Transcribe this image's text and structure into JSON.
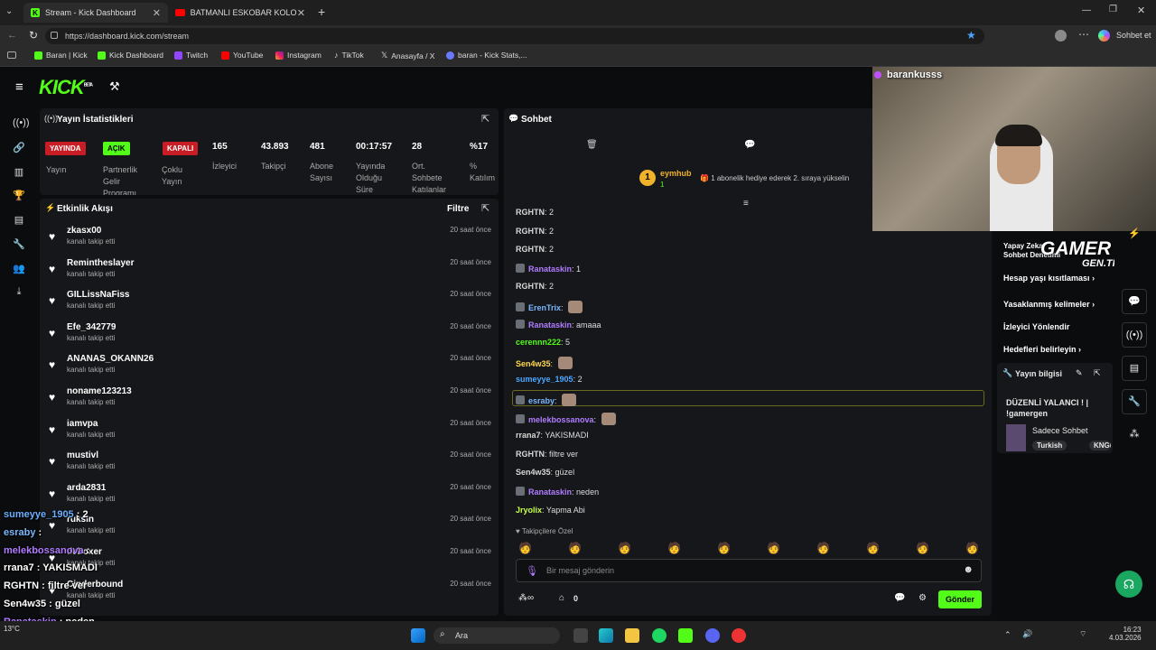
{
  "browser": {
    "tabs": [
      {
        "title": "Stream - Kick Dashboard"
      },
      {
        "title": "BATMANLI ESKOBAR KOLOMBİYA'"
      }
    ],
    "url": "https://dashboard.kick.com/stream",
    "copilot": "Sohbet et",
    "bookmarks": [
      "Baran | Kick",
      "Kick Dashboard",
      "Twitch",
      "YouTube",
      "Instagram",
      "TikTok",
      "Anasayfa / X",
      "baran - Kick Stats,..."
    ]
  },
  "logo": "KICK",
  "logo_beta": "BETA",
  "stats": {
    "title": "Yayın İstatistikleri",
    "badges": [
      {
        "text": "YAYINDA",
        "label": "Yayın"
      },
      {
        "text": "AÇIK",
        "label": "Partnerlik\nGelir\nProgramı"
      },
      {
        "text": "KAPALI",
        "label": "Çoklu\nYayın"
      }
    ],
    "items": [
      {
        "value": "165",
        "label": "İzleyici"
      },
      {
        "value": "43.893",
        "label": "Takipçi"
      },
      {
        "value": "481",
        "label": "Abone\nSayısı"
      },
      {
        "value": "00:17:57",
        "label": "Yayında\nOlduğu\nSüre"
      },
      {
        "value": "28",
        "label": "Ort.\nSohbete\nKatılanlar"
      },
      {
        "value": "%17",
        "label": "%\nKatılım"
      }
    ]
  },
  "activity": {
    "title": "Etkinlik Akışı",
    "filter": "Filtre",
    "rows": [
      {
        "name": "zkasx00",
        "sub": "kanalı takip etti",
        "time": "20 saat önce"
      },
      {
        "name": "Remintheslayer",
        "sub": "kanalı takip etti",
        "time": "20 saat önce"
      },
      {
        "name": "GILLissNaFiss",
        "sub": "kanalı takip etti",
        "time": "20 saat önce"
      },
      {
        "name": "Efe_342779",
        "sub": "kanalı takip etti",
        "time": "20 saat önce"
      },
      {
        "name": "ANANAS_OKANN26",
        "sub": "kanalı takip etti",
        "time": "20 saat önce"
      },
      {
        "name": "noname123213",
        "sub": "kanalı takip etti",
        "time": "20 saat önce"
      },
      {
        "name": "iamvpa",
        "sub": "kanalı takip etti",
        "time": "20 saat önce"
      },
      {
        "name": "mustivl",
        "sub": "kanalı takip etti",
        "time": "20 saat önce"
      },
      {
        "name": "arda2831",
        "sub": "kanalı takip etti",
        "time": "20 saat önce"
      },
      {
        "name": "ruksin",
        "sub": "kanalı takip etti",
        "time": "20 saat önce"
      },
      {
        "name": "deboxer",
        "sub": "kanalı takip etti",
        "time": "20 saat önce"
      },
      {
        "name": "Cinderbound",
        "sub": "kanalı takip etti",
        "time": "20 saat önce"
      }
    ]
  },
  "chat": {
    "title": "Sohbet",
    "pinned_user": "eymhub",
    "pinned_num": "1",
    "pinned_msg": "1 abonelik hediye ederek 2. sıraya yükselin",
    "messages": [
      {
        "user": "RGHTN",
        "color": "#d7d7d7",
        "text": "2"
      },
      {
        "user": "RGHTN",
        "color": "#d7d7d7",
        "text": "2"
      },
      {
        "user": "RGHTN",
        "color": "#d7d7d7",
        "text": "2"
      },
      {
        "user": "Ranataskin",
        "color": "#b07cff",
        "text": "1",
        "badge": true
      },
      {
        "user": "RGHTN",
        "color": "#d7d7d7",
        "text": "2"
      },
      {
        "user": "ErenTrix",
        "color": "#7ab8ff",
        "text": "",
        "badge": true,
        "emote": true
      },
      {
        "user": "Ranataskin",
        "color": "#b07cff",
        "text": "amaaa",
        "badge": true
      },
      {
        "user": "cerennn222",
        "color": "#53fc18",
        "text": "5"
      },
      {
        "user": "Sen4w35",
        "color": "#ffd84d",
        "text": "",
        "emote": true
      },
      {
        "user": "sumeyye_1905",
        "color": "#4da6ff",
        "text": "2"
      },
      {
        "user": "esraby",
        "color": "#7ab8ff",
        "text": "",
        "badge": true,
        "emote": true,
        "highlight": true
      },
      {
        "user": "melekbossanova",
        "color": "#b07cff",
        "text": "",
        "badge": true,
        "emote": true
      },
      {
        "user": "rrana7",
        "color": "#d7d7d7",
        "text": "YAKISMADI"
      },
      {
        "user": "RGHTN",
        "color": "#d7d7d7",
        "text": "filtre ver"
      },
      {
        "user": "Sen4w35",
        "color": "#d7d7d7",
        "text": "güzel"
      },
      {
        "user": "Ranataskin",
        "color": "#b07cff",
        "text": "neden",
        "badge": true
      },
      {
        "user": "Jryolix",
        "color": "#c6ff4d",
        "text": "Yapma Abi"
      }
    ],
    "followers_only": "Takipçilere Özel",
    "input_placeholder": "Bir mesaj gönderin",
    "points": "0",
    "send": "Gönder"
  },
  "webcam": {
    "name": "barankusss"
  },
  "right": {
    "items": [
      "Yapay Zeka",
      "Sohbet Denetimi",
      "Hesap yaşı kısıtlaması",
      "Yasaklanmış kelimeler",
      "İzleyici Yönlendir",
      "Hedefleri belirleyin"
    ],
    "info_title": "Yayın bilgisi",
    "stream_title": "DÜZENLİ YALANCI ! | !gamergen",
    "category": "Sadece Sohbet",
    "tags": [
      "Turkish",
      "KNGL"
    ],
    "watermark": "GAMER",
    "watermark_sub": "GEN.TR"
  },
  "overlay": [
    {
      "user": "sumeyye_1905",
      "text": " : 2",
      "color": "#6ab0ff"
    },
    {
      "user": "esraby",
      "text": " :",
      "color": "#7ab8ff"
    },
    {
      "user": "melekbossanova",
      "text": " :",
      "color": "#b07cff"
    },
    {
      "user": "rrana7",
      "text": " : YAKISMADI",
      "color": "#ffffff"
    },
    {
      "user": "RGHTN",
      "text": " : filtre ver",
      "color": "#ffffff"
    },
    {
      "user": "Sen4w35",
      "text": " : güzel",
      "color": "#ffffff"
    },
    {
      "user": "Ranataskin",
      "text": " : neden",
      "color": "#b07cff"
    },
    {
      "user": "Jryolix",
      "text": " : Yapma Abi",
      "color": "#c6ff4d"
    }
  ],
  "taskbar": {
    "search": "Ara",
    "weather": "13°C",
    "time": "16:23",
    "date": "4.03.2026"
  }
}
